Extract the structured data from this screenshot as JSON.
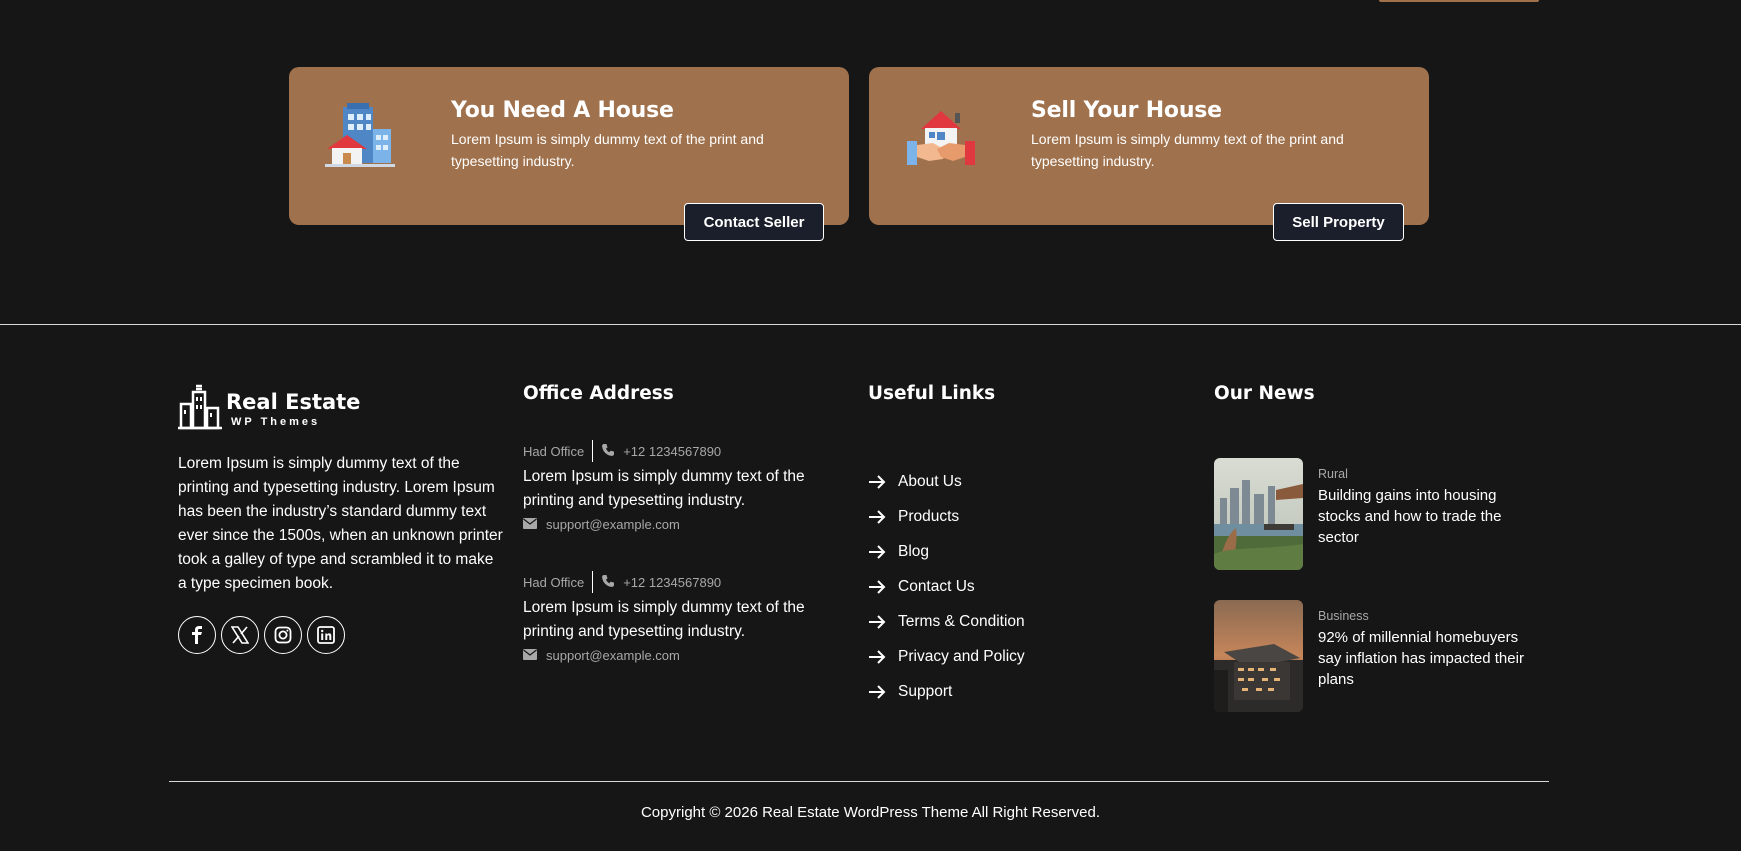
{
  "cta_cards": [
    {
      "title": "You Need A House",
      "description": "Lorem Ipsum is simply dummy text of the print and typesetting industry.",
      "button_label": "Contact Seller",
      "icon": "house-building-icon"
    },
    {
      "title": "Sell Your House",
      "description": "Lorem Ipsum is simply dummy text of the print and typesetting industry.",
      "button_label": "Sell Property",
      "icon": "handshake-house-icon"
    }
  ],
  "brand": {
    "name": "Real Estate",
    "tagline": "WP Themes",
    "about": "Lorem Ipsum is simply dummy text of the printing and typesetting industry. Lorem Ipsum has been the industry’s standard dummy text ever since the 1500s, when an unknown printer took a galley of type and scrambled it to make a type specimen book.",
    "socials": [
      "facebook-icon",
      "x-icon",
      "instagram-icon",
      "linkedin-icon"
    ]
  },
  "office": {
    "title": "Office Address",
    "entries": [
      {
        "label": "Had Office",
        "phone": "+12 1234567890",
        "address": "Lorem Ipsum is simply dummy text of the printing and typesetting industry.",
        "email": "support@example.com"
      },
      {
        "label": "Had Office",
        "phone": "+12 1234567890",
        "address": "Lorem Ipsum is simply dummy text of the printing and typesetting industry.",
        "email": "support@example.com"
      }
    ]
  },
  "useful_links": {
    "title": "Useful Links",
    "items": [
      "About Us",
      "Products",
      "Blog",
      "Contact Us",
      "Terms & Condition",
      "Privacy and Policy",
      "Support"
    ]
  },
  "news": {
    "title": "Our News",
    "items": [
      {
        "category": "Rural",
        "headline": "Building gains into housing stocks and how to trade the sector"
      },
      {
        "category": "Business",
        "headline": "92% of millennial homebuyers say inflation has impacted their plans"
      }
    ]
  },
  "footer": {
    "copyright": "Copyright © 2026 Real Estate WordPress Theme All Right Reserved."
  },
  "colors": {
    "background": "#161616",
    "card": "#9f714c",
    "button": "#1b1f2b",
    "muted_text": "#a8a8a8"
  }
}
